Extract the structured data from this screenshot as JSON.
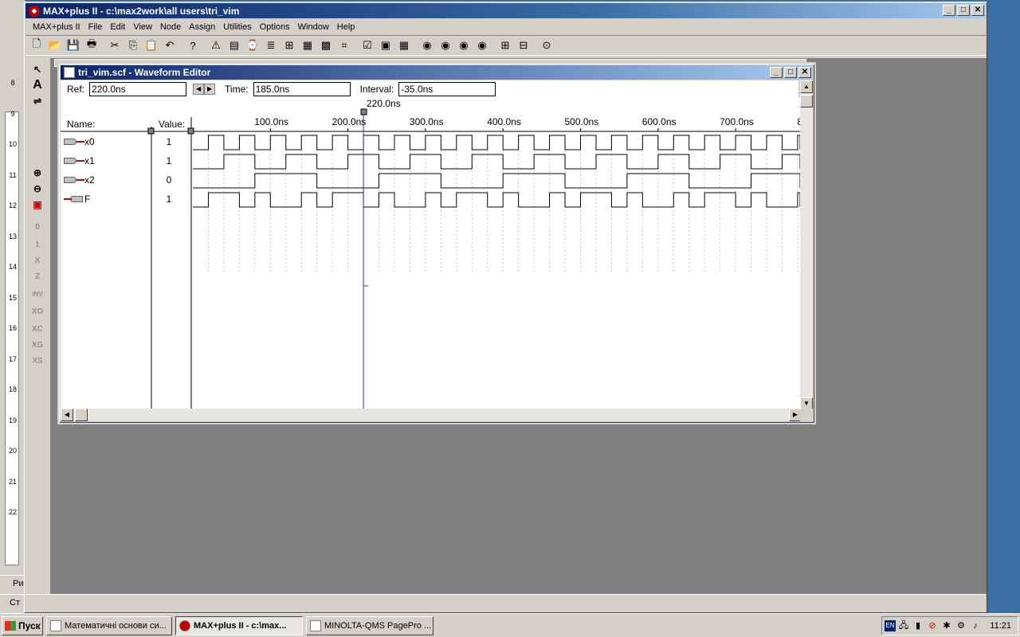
{
  "main_window": {
    "title": "MAX+plus II - c:\\max2work\\all users\\tri_vim",
    "buttons": {
      "minimize": "_",
      "maximize": "□",
      "close": "✕"
    }
  },
  "menu": [
    "MAX+plus II",
    "File",
    "Edit",
    "View",
    "Node",
    "Assign",
    "Utilities",
    "Options",
    "Window",
    "Help"
  ],
  "toolbar_icons": [
    "new-icon",
    "open-icon",
    "save-icon",
    "print-icon",
    "cut-icon",
    "copy-icon",
    "paste-icon",
    "undo-icon",
    "help-icon",
    "compile-icon",
    "simulate-icon",
    "timing-icon",
    "report-icon",
    "hierarchy-icon",
    "project-icon",
    "floorplan-icon",
    "program-icon",
    "save-check-icon",
    "save-sim-icon",
    "save-all-icon",
    "probe-icon",
    "probe-ab-icon",
    "probe-group-icon",
    "probe-sim-icon",
    "grid-icon",
    "grid2-icon",
    "zoom-find-icon"
  ],
  "palette": [
    "pointer-tool",
    "text-tool",
    "node-tool",
    "zoom-in",
    "zoom-out",
    "fit-window",
    "low-0",
    "high-1",
    "unknown-x",
    "hi-z",
    "invert",
    "overwrite-value",
    "overwrite-clock",
    "overwrite-group",
    "overwrite-sequence"
  ],
  "palette_labels": {
    "text": "A",
    "zero": "0",
    "one": "1",
    "x": "X",
    "z": "Z",
    "inv": "INV",
    "xo": "XO",
    "xc": "XC",
    "xg": "XG",
    "xs": "XS"
  },
  "waveform_window": {
    "title": "tri_vim.scf - Waveform Editor",
    "ref_label": "Ref:",
    "ref_value": "220.0ns",
    "time_label": "Time:",
    "time_value": "185.0ns",
    "interval_label": "Interval:",
    "interval_value": "-35.0ns",
    "cursor_label": "220.0ns",
    "name_header": "Name:",
    "value_header": "Value:",
    "time_ticks": [
      "100.0ns",
      "200.0ns",
      "300.0ns",
      "400.0ns",
      "500.0ns",
      "600.0ns",
      "700.0ns",
      "8"
    ],
    "signals": [
      {
        "name": "x0",
        "value": "1",
        "type": "input",
        "period_ns": 40
      },
      {
        "name": "x1",
        "value": "1",
        "type": "input",
        "period_ns": 80
      },
      {
        "name": "x2",
        "value": "0",
        "type": "input",
        "period_ns": 160
      },
      {
        "name": "F",
        "value": "1",
        "type": "output"
      }
    ]
  },
  "taskbar": {
    "start": "Пуск",
    "tasks": [
      "Математичні основи си...",
      "MAX+plus II - c:\\max...",
      "MINOLTA-QMS PagePro ..."
    ],
    "lang": "EN",
    "clock": "11:21"
  },
  "bg_window": {
    "status_text": "Ст",
    "ruler_ticks": [
      "8",
      "9",
      "10",
      "11",
      "12",
      "13",
      "14",
      "15",
      "16",
      "17",
      "18",
      "19",
      "20",
      "21",
      "22"
    ],
    "draw_label": "Ри"
  }
}
